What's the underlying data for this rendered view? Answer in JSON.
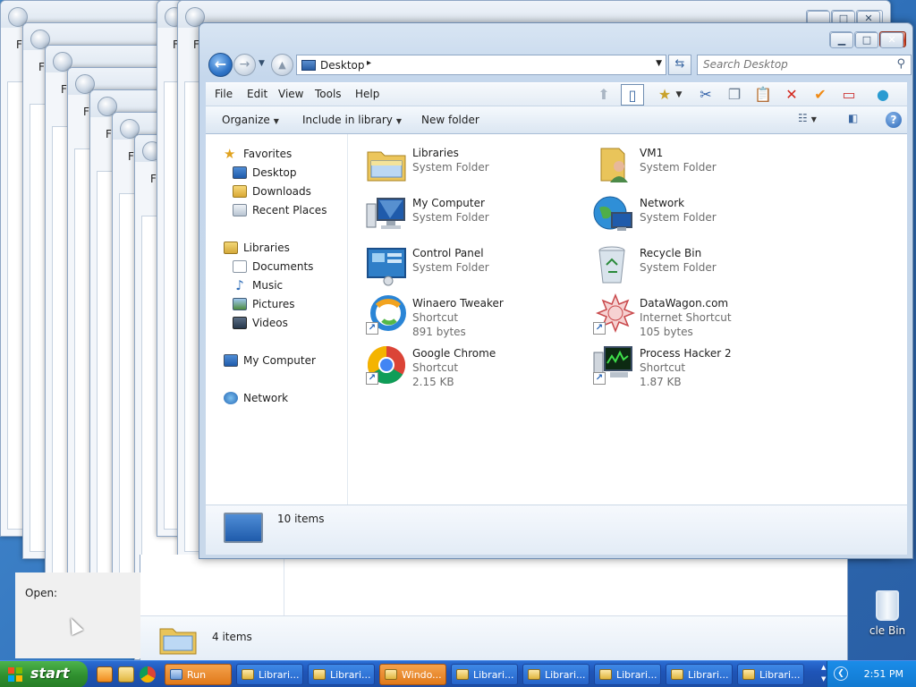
{
  "desktop": {
    "recycle_bin_label": "cle Bin"
  },
  "background_windows": {
    "menu_letter": "F"
  },
  "run_dialog": {
    "open_label": "Open:"
  },
  "second_explorer": {
    "status_count": "4 items"
  },
  "main_window": {
    "address": {
      "location": "Desktop",
      "separator": "▸"
    },
    "search": {
      "placeholder": "Search Desktop"
    },
    "menu": [
      "File",
      "Edit",
      "View",
      "Tools",
      "Help"
    ],
    "command_bar": {
      "organize": "Organize",
      "include_in_library": "Include in library",
      "new_folder": "New folder"
    },
    "nav_pane": {
      "favorites": "Favorites",
      "favorites_items": [
        "Desktop",
        "Downloads",
        "Recent Places"
      ],
      "libraries": "Libraries",
      "libraries_items": [
        "Documents",
        "Music",
        "Pictures",
        "Videos"
      ],
      "my_computer": "My Computer",
      "network": "Network"
    },
    "items": [
      {
        "name": "Libraries",
        "type": "System Folder",
        "size": "",
        "icon": "libraries-folder-icon"
      },
      {
        "name": "VM1",
        "type": "System Folder",
        "size": "",
        "icon": "user-folder-icon"
      },
      {
        "name": "My Computer",
        "type": "System Folder",
        "size": "",
        "icon": "computer-icon"
      },
      {
        "name": "Network",
        "type": "System Folder",
        "size": "",
        "icon": "network-globe-icon"
      },
      {
        "name": "Control Panel",
        "type": "System Folder",
        "size": "",
        "icon": "control-panel-icon"
      },
      {
        "name": "Recycle Bin",
        "type": "System Folder",
        "size": "",
        "icon": "recycle-bin-icon"
      },
      {
        "name": "Winaero Tweaker",
        "type": "Shortcut",
        "size": "891 bytes",
        "icon": "winaero-tweaker-icon"
      },
      {
        "name": "DataWagon.com",
        "type": "Internet Shortcut",
        "size": "105 bytes",
        "icon": "datawagon-icon"
      },
      {
        "name": "Google Chrome",
        "type": "Shortcut",
        "size": "2.15 KB",
        "icon": "chrome-icon"
      },
      {
        "name": "Process Hacker 2",
        "type": "Shortcut",
        "size": "1.87 KB",
        "icon": "process-hacker-icon"
      }
    ],
    "details": {
      "count": "10 items"
    }
  },
  "taskbar": {
    "start_label": "start",
    "buttons": [
      "Run",
      "Librari...",
      "Librari...",
      "Windo...",
      "Librari...",
      "Librari...",
      "Librari...",
      "Librari...",
      "Librari..."
    ],
    "clock": "2:51 PM"
  },
  "colors": {
    "accent": "#2f74c7",
    "taskbar": "#1f55b8",
    "start_green": "#2f8f2e",
    "active_task": "#e0791a"
  }
}
